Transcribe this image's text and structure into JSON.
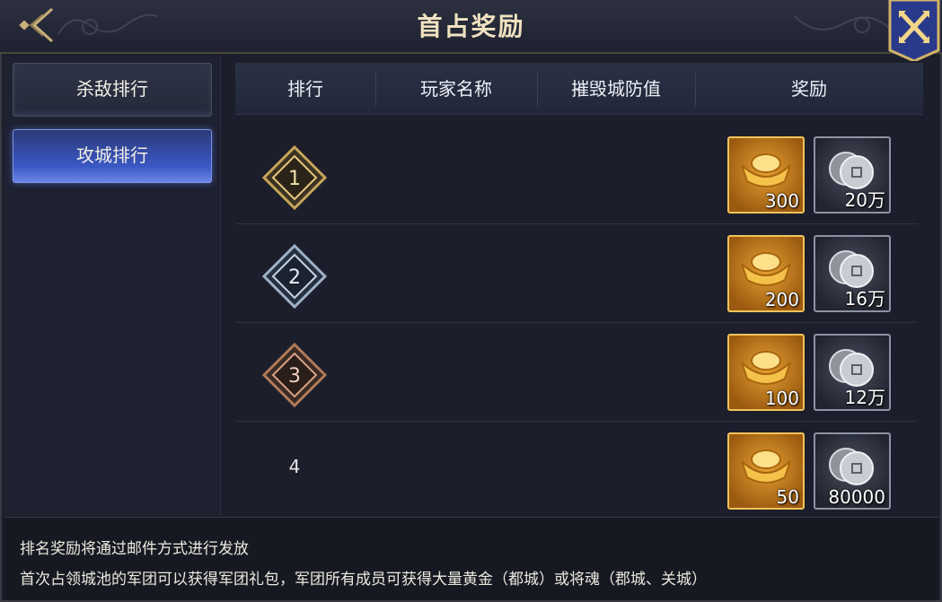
{
  "header": {
    "title": "首占奖励"
  },
  "tabs": [
    {
      "label": "杀敌排行",
      "active": false
    },
    {
      "label": "攻城排行",
      "active": true
    }
  ],
  "table": {
    "columns": [
      "排行",
      "玩家名称",
      "摧毁城防值",
      "奖励"
    ],
    "rows": [
      {
        "rank": "1",
        "player": "",
        "defense": "",
        "gold": "300",
        "silver": "20万",
        "badge_color": "#c9a45a"
      },
      {
        "rank": "2",
        "player": "",
        "defense": "",
        "gold": "200",
        "silver": "16万",
        "badge_color": "#9fb2c8"
      },
      {
        "rank": "3",
        "player": "",
        "defense": "",
        "gold": "100",
        "silver": "12万",
        "badge_color": "#b07a58"
      },
      {
        "rank": "4",
        "player": "",
        "defense": "",
        "gold": "50",
        "silver": "80000",
        "badge_color": ""
      }
    ]
  },
  "footer": {
    "notes": [
      "排名奖励将通过邮件方式进行发放",
      "首次占领城池的军团可以获得军团礼包，军团所有成员可获得大量黄金（都城）或将魂（郡城、关城）"
    ]
  },
  "icons": {
    "back": "back-arrow-icon",
    "close": "close-x-icon",
    "gold": "gold-ingot-icon",
    "silver": "silver-coin-icon",
    "rank_badge": "rank-diamond-icon"
  },
  "colors": {
    "accent_blue": "#3a58c5",
    "gold_border": "#f1c35a",
    "title_text": "#f0e2c0"
  }
}
